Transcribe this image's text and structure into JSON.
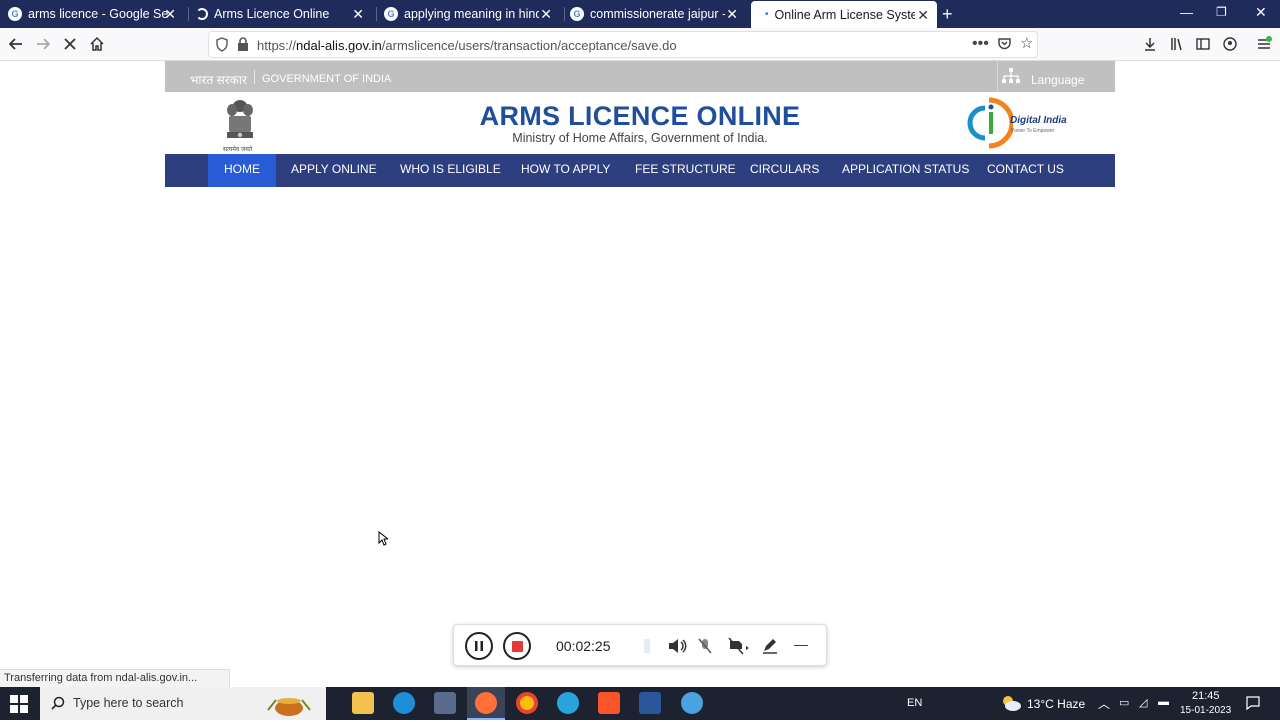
{
  "browser": {
    "tabs": [
      {
        "title": "arms licence - Google Search",
        "fav": "google-icon"
      },
      {
        "title": "Arms Licence Online",
        "fav": "loading-icon"
      },
      {
        "title": "applying meaning in hindi",
        "fav": "google-icon"
      },
      {
        "title": "commissionerate jaipur - G",
        "fav": "google-icon"
      },
      {
        "title": "Online Arm License System",
        "fav": "dot-icon"
      }
    ],
    "url_prefix": "https://",
    "url_domain": "ndal-alis.gov.in",
    "url_path": "/armslicence/users/transaction/acceptance/save.do",
    "status_text": "Transferring data from ndal-alis.gov.in..."
  },
  "site": {
    "hindi_gov": "भारत सरकार",
    "gov_en": "GOVERNMENT OF INDIA",
    "language": "Language",
    "title": "ARMS LICENCE ONLINE",
    "subtitle": "Ministry of Home Affairs, Government of India.",
    "emblem_motto": "सत्यमेव जयते",
    "digital_india": "Digital India",
    "digital_india_tag": "Power To Empower",
    "menu": [
      "HOME",
      "APPLY ONLINE",
      "WHO IS ELIGIBLE",
      "HOW TO APPLY",
      "FEE STRUCTURE",
      "CIRCULARS",
      "APPLICATION STATUS",
      "CONTACT US"
    ],
    "active_menu": "HOME"
  },
  "recorder": {
    "time": "00:02:25"
  },
  "taskbar": {
    "search_placeholder": "Type here to search",
    "lang": "EN",
    "weather": "13°C  Haze",
    "time": "21:45",
    "date": "15-01-2023"
  },
  "colors": {
    "tabbar": "#1f2b5b",
    "menu": "#2e3f7f",
    "menu_active": "#2a5bd7",
    "title_blue": "#1f4e9c"
  }
}
